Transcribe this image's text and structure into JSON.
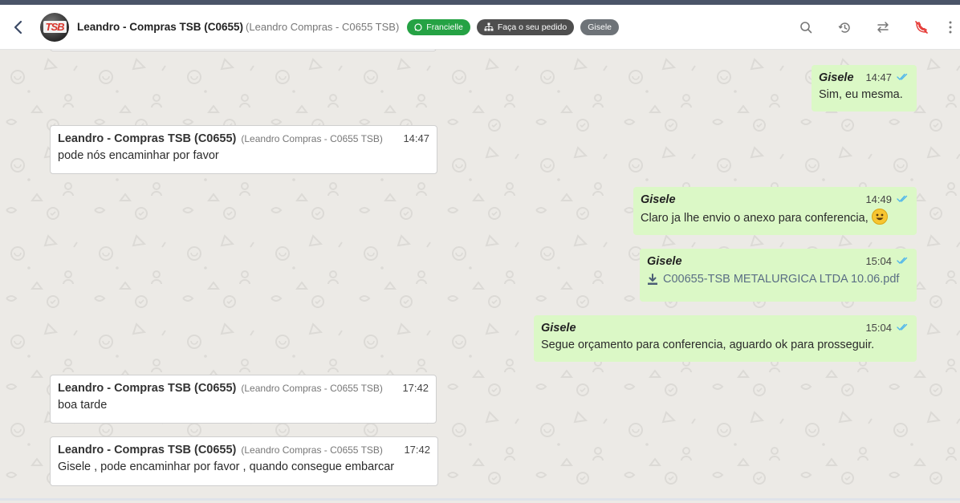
{
  "header": {
    "contact_name": "Leandro - Compras TSB (C0655)",
    "contact_sub": "(Leandro Compras - C0655 TSB)",
    "avatar_text": "TSB",
    "badges": [
      {
        "label": "Francielle",
        "icon": "whatsapp-icon",
        "color": "#25a244"
      },
      {
        "label": "Faça o seu pedido",
        "icon": "sitemap-icon",
        "color": "#4e4e4e"
      },
      {
        "label": "Gisele",
        "color": "#6e7378"
      }
    ],
    "actions": [
      "search-icon",
      "history-icon",
      "transfer-icon",
      "end-call-icon",
      "more-vert-icon"
    ]
  },
  "colors": {
    "incoming_bg": "#ffffff",
    "outgoing_bg": "#dbf8c6",
    "read_tick": "#4fb6ec",
    "end_call": "#e53935"
  },
  "messages": [
    {
      "dir": "out",
      "sender": "Gisele",
      "time": "14:47",
      "text": "Sim, eu mesma."
    },
    {
      "dir": "in",
      "sender": "Leandro - Compras TSB (C0655)",
      "sub": "(Leandro Compras - C0655 TSB)",
      "time": "14:47",
      "text": "pode nós encaminhar por favor"
    },
    {
      "dir": "out",
      "sender": "Gisele",
      "time": "14:49",
      "text": "Claro ja lhe envio o anexo para conferencia,",
      "emoji": "grinning-face"
    },
    {
      "dir": "out",
      "sender": "Gisele",
      "time": "15:04",
      "attachment": "C00655-TSB METALURGICA LTDA 10.06.pdf"
    },
    {
      "dir": "out",
      "sender": "Gisele",
      "time": "15:04",
      "text": "Segue orçamento para conferencia, aguardo ok para prosseguir."
    },
    {
      "dir": "in",
      "sender": "Leandro - Compras TSB (C0655)",
      "sub": "(Leandro Compras - C0655 TSB)",
      "time": "17:42",
      "text": "boa tarde"
    },
    {
      "dir": "in",
      "sender": "Leandro - Compras TSB (C0655)",
      "sub": "(Leandro Compras - C0655 TSB)",
      "time": "17:42",
      "text": "Gisele , pode encaminhar por favor , quando consegue embarcar"
    }
  ]
}
